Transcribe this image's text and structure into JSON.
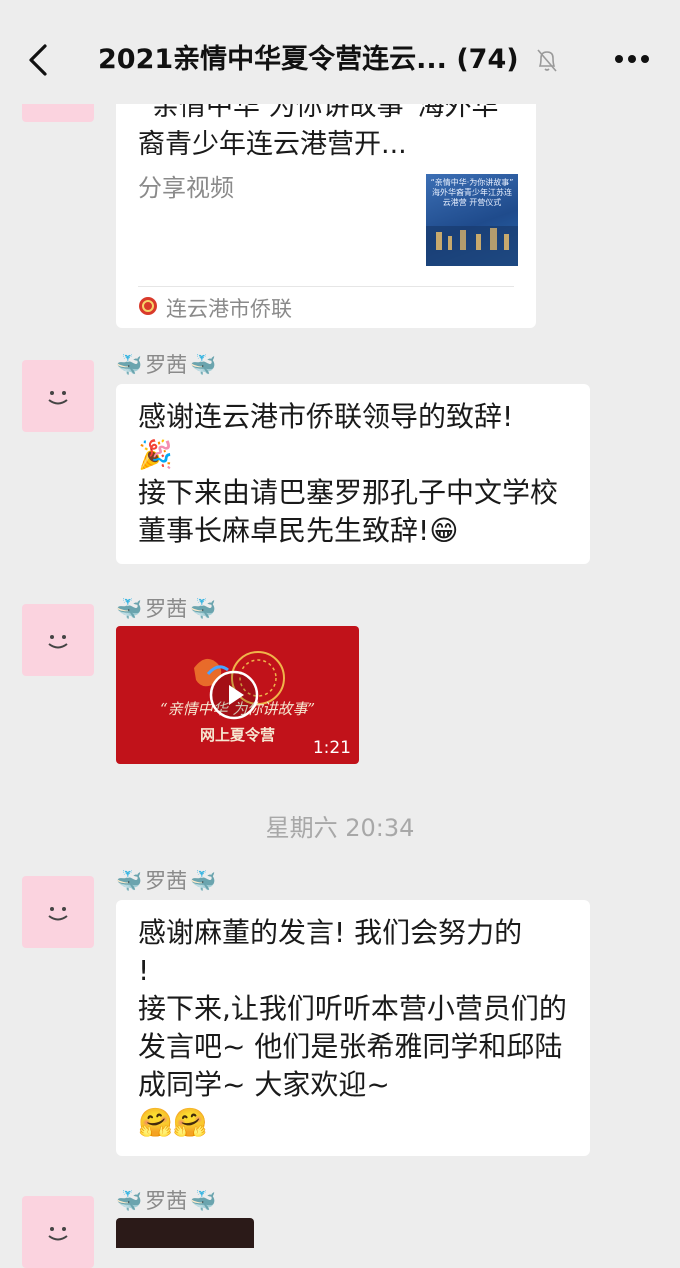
{
  "header": {
    "title": "2021亲情中华夏令营连云... (74)",
    "back_icon": "chevron-left-icon",
    "mute_icon": "bell-off-icon",
    "more_icon": "more-dots-icon"
  },
  "share_card": {
    "title": "“亲情中华 为你讲故事”海外华裔青少年连云港营开...",
    "subtitle": "分享视频",
    "source": "连云港市侨联",
    "thumb_caption": "“亲情中华·为你讲故事” 海外华裔青少年江苏连云港营 开营仪式"
  },
  "messages": [
    {
      "sender": "罗茜",
      "text": "感谢连云港市侨联领导的致辞!\n🎉\n接下来由请巴塞罗那孔子中文学校董事长麻卓民先生致辞!😁"
    },
    {
      "sender": "罗茜",
      "video_caption_1": "“亲情中华 为你讲故事”",
      "video_caption_2": "网上夏令营",
      "video_duration": "1:21"
    },
    {
      "sender": "罗茜",
      "text": "感谢麻董的发言! 我们会努力的\n!\n接下来,让我们听听本营小营员们的发言吧~ 他们是张希雅同学和邱陆成同学~ 大家欢迎~\n🤗🤗"
    },
    {
      "sender": "罗茜"
    }
  ],
  "timestamp": "星期六 20:34",
  "colors": {
    "background": "#ededed",
    "bubble": "#ffffff",
    "avatar_bg": "#fbd3df",
    "video_red": "#c1121a"
  }
}
